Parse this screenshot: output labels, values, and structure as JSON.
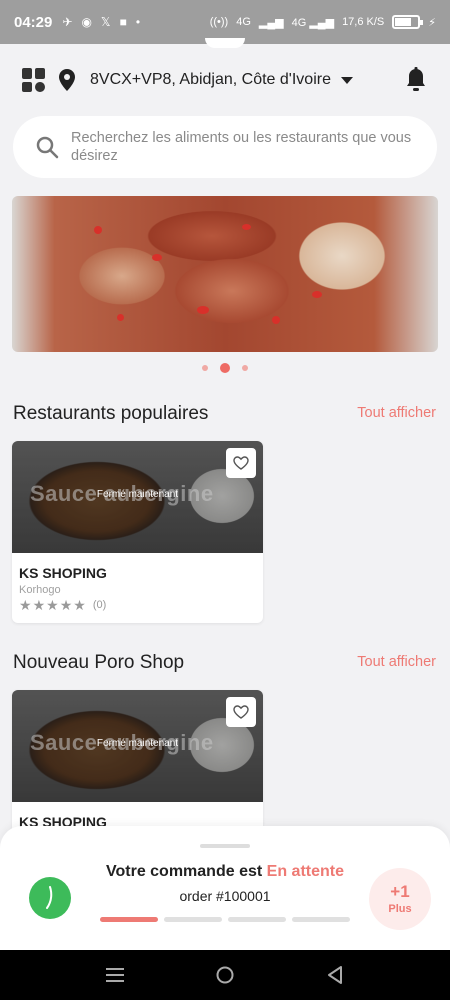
{
  "status_bar": {
    "time": "04:29",
    "network": "4G",
    "speed": "17,6 K/S"
  },
  "header": {
    "address": "8VCX+VP8, Abidjan, Côte d'Ivoire"
  },
  "search": {
    "placeholder": "Recherchez les aliments ou les restaurants que vous désirez"
  },
  "carousel": {
    "active_index": 1,
    "count": 3
  },
  "sections": {
    "popular": {
      "title": "Restaurants populaires",
      "see_all": "Tout afficher"
    },
    "new": {
      "title": "Nouveau Poro Shop",
      "see_all": "Tout afficher"
    }
  },
  "cards": {
    "popular_1": {
      "watermark": "Sauce aubergine",
      "closed": "Fermé maintenant",
      "name": "KS SHOPING",
      "city": "Korhogo",
      "rating": 0,
      "reviews": "(0)"
    },
    "new_1": {
      "watermark": "Sauce aubergine",
      "closed": "Fermé maintenant",
      "name": "KS SHOPING"
    }
  },
  "order": {
    "title_prefix": "Votre commande est",
    "status": "En attente",
    "number": "order #100001",
    "plus_count": "+1",
    "plus_label": "Plus",
    "progress_steps": 4,
    "progress_done": 1
  },
  "colors": {
    "accent": "#ee7a74",
    "status_green": "#3dbb5a"
  }
}
